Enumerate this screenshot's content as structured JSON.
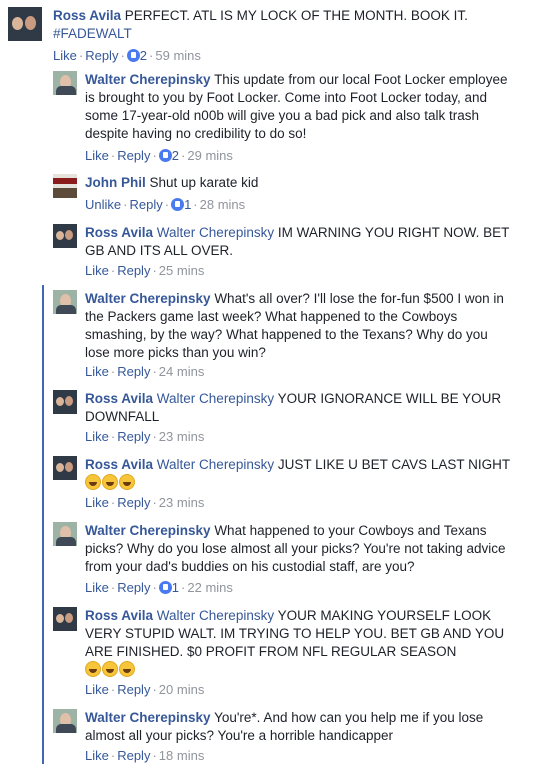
{
  "comments": [
    {
      "author": "Ross Avila",
      "mention": "",
      "text": "PERFECT. ATL IS MY LOCK OF THE MONTH. BOOK IT.",
      "hashtag": "#FADEWALT",
      "like_label": "Like",
      "reply_label": "Reply",
      "likes": "2",
      "time": "59 mins"
    },
    {
      "author": "Walter Cherepinsky",
      "mention": "",
      "text": "This update from our local Foot Locker employee is brought to you by Foot Locker. Come into Foot Locker today, and some 17-year-old n00b will give you a bad pick and also talk trash despite having no credibility to do so!",
      "like_label": "Like",
      "reply_label": "Reply",
      "likes": "2",
      "time": "29 mins"
    },
    {
      "author": "John Phil",
      "mention": "",
      "text": "Shut up karate kid",
      "like_label": "Unlike",
      "reply_label": "Reply",
      "likes": "1",
      "time": "28 mins"
    },
    {
      "author": "Ross Avila",
      "mention": "Walter Cherepinsky",
      "text": "IM WARNING YOU RIGHT NOW. BET GB AND ITS ALL OVER.",
      "like_label": "Like",
      "reply_label": "Reply",
      "time": "25 mins"
    },
    {
      "author": "Walter Cherepinsky",
      "mention": "",
      "text": "What's all over? I'll lose the for-fun $500 I won in the Packers game last week? What happened to the Cowboys smashing, by the way? What happened to the Texans? Why do you lose more picks than you win?",
      "like_label": "Like",
      "reply_label": "Reply",
      "time": "24 mins"
    },
    {
      "author": "Ross Avila",
      "mention": "Walter Cherepinsky",
      "text": "YOUR IGNORANCE WILL BE YOUR DOWNFALL",
      "like_label": "Like",
      "reply_label": "Reply",
      "time": "23 mins"
    },
    {
      "author": "Ross Avila",
      "mention": "Walter Cherepinsky",
      "text": "JUST LIKE U BET CAVS LAST NIGHT",
      "emoji": "laughing-face-emoji",
      "like_label": "Like",
      "reply_label": "Reply",
      "time": "23 mins"
    },
    {
      "author": "Walter Cherepinsky",
      "mention": "",
      "text": "What happened to your Cowboys and Texans picks? Why do you lose almost all your picks? You're not taking advice from your dad's buddies on his custodial staff, are you?",
      "like_label": "Like",
      "reply_label": "Reply",
      "likes": "1",
      "time": "22 mins"
    },
    {
      "author": "Ross Avila",
      "mention": "Walter Cherepinsky",
      "text": "YOUR MAKING YOURSELF LOOK VERY STUPID WALT. IM TRYING TO HELP YOU. BET GB AND YOU ARE FINISHED. $0 PROFIT FROM NFL REGULAR SEASON",
      "emoji": "laughing-face-emoji",
      "like_label": "Like",
      "reply_label": "Reply",
      "time": "20 mins"
    },
    {
      "author": "Walter Cherepinsky",
      "mention": "",
      "text": "You're*. And how can you help me if you lose almost all your picks? You're a horrible handicapper",
      "like_label": "Like",
      "reply_label": "Reply",
      "time": "18 mins"
    }
  ],
  "colors": {
    "link": "#365899",
    "thread_line": "#4267b2",
    "meta": "#90949c"
  }
}
